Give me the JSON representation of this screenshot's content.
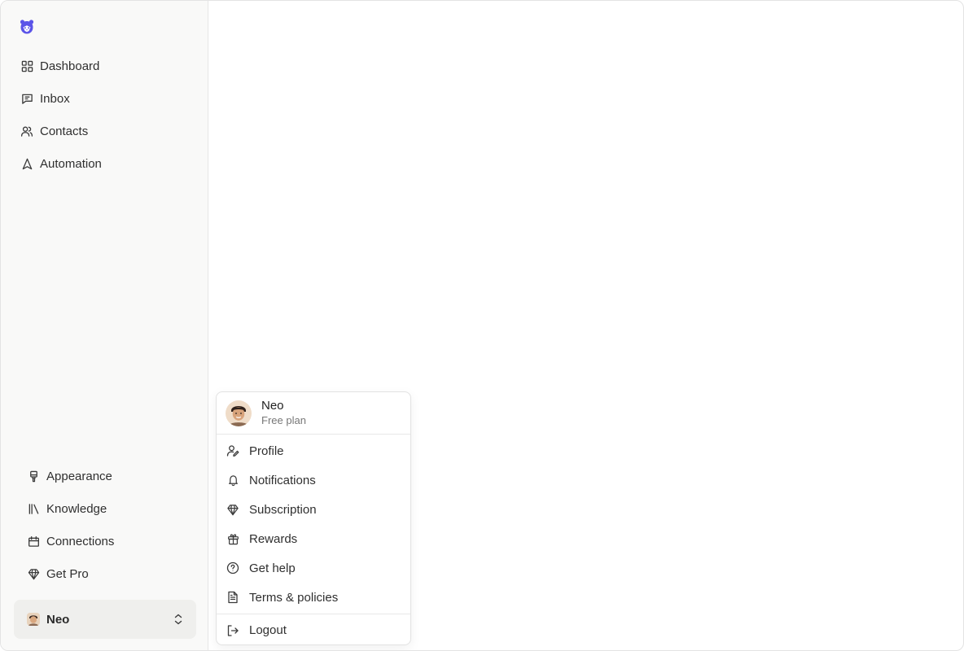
{
  "app": {
    "logo": "bear-logo-icon",
    "accent": "#5b54e8"
  },
  "sidebar": {
    "items": [
      {
        "label": "Dashboard",
        "icon": "grid-icon"
      },
      {
        "label": "Inbox",
        "icon": "message-icon"
      },
      {
        "label": "Contacts",
        "icon": "users-icon"
      },
      {
        "label": "Automation",
        "icon": "navigation-icon"
      }
    ],
    "bottom_items": [
      {
        "label": "Appearance",
        "icon": "brush-icon"
      },
      {
        "label": "Knowledge",
        "icon": "library-icon"
      },
      {
        "label": "Connections",
        "icon": "calendar-icon"
      },
      {
        "label": "Get Pro",
        "icon": "gem-icon"
      }
    ],
    "user": {
      "name": "Neo",
      "icon": "chevrons-up-down-icon"
    }
  },
  "menu": {
    "user_name": "Neo",
    "plan": "Free plan",
    "items": [
      {
        "label": "Profile",
        "icon": "user-pen-icon"
      },
      {
        "label": "Notifications",
        "icon": "bell-icon"
      },
      {
        "label": "Subscription",
        "icon": "gem-icon"
      },
      {
        "label": "Rewards",
        "icon": "gift-icon"
      },
      {
        "label": "Get help",
        "icon": "help-circle-icon"
      },
      {
        "label": "Terms & policies",
        "icon": "file-text-icon"
      }
    ],
    "logout": {
      "label": "Logout",
      "icon": "logout-icon"
    }
  }
}
